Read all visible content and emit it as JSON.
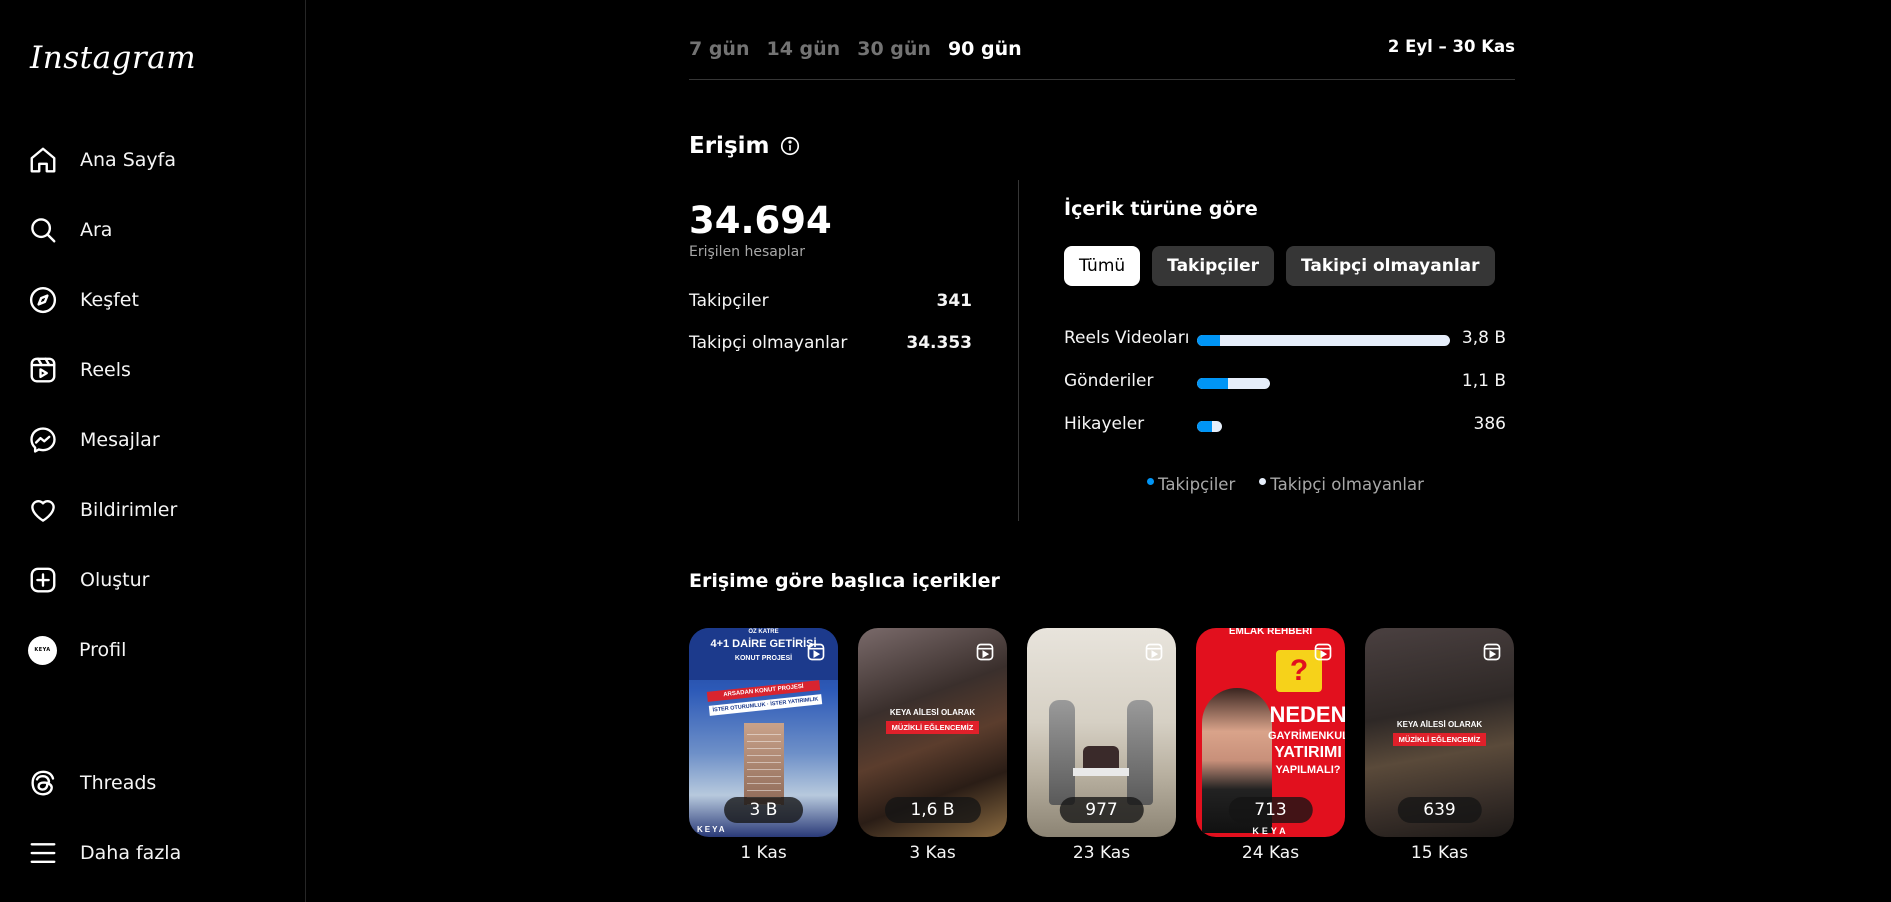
{
  "sidebar": {
    "logo": "Instagram",
    "items": [
      {
        "label": "Ana Sayfa",
        "icon": "home-icon"
      },
      {
        "label": "Ara",
        "icon": "search-icon"
      },
      {
        "label": "Keşfet",
        "icon": "compass-icon"
      },
      {
        "label": "Reels",
        "icon": "reels-icon"
      },
      {
        "label": "Mesajlar",
        "icon": "messenger-icon"
      },
      {
        "label": "Bildirimler",
        "icon": "heart-icon"
      },
      {
        "label": "Oluştur",
        "icon": "plus-square-icon"
      },
      {
        "label": "Profil",
        "icon": "avatar"
      }
    ],
    "bottom_items": [
      {
        "label": "Threads",
        "icon": "threads-icon"
      },
      {
        "label": "Daha fazla",
        "icon": "menu-icon"
      }
    ],
    "avatar_text": "KEYA"
  },
  "range": {
    "tabs": [
      "7 gün",
      "14 gün",
      "30 gün",
      "90 gün"
    ],
    "active": "90 gün",
    "date_range": "2 Eyl – 30 Kas"
  },
  "reach": {
    "title": "Erişim",
    "total": "34.694",
    "total_label": "Erişilen hesaplar",
    "rows": [
      {
        "label": "Takipçiler",
        "value": "341"
      },
      {
        "label": "Takipçi olmayanlar",
        "value": "34.353"
      }
    ]
  },
  "content_type": {
    "title": "İçerik türüne göre",
    "filters": [
      "Tümü",
      "Takipçiler",
      "Takipçi olmayanlar"
    ],
    "active_filter": "Tümü",
    "bars": [
      {
        "label": "Reels Videoları",
        "value": "3,8 B",
        "total_fraction": 1.0,
        "follower_fraction": 0.09
      },
      {
        "label": "Gönderiler",
        "value": "1,1 B",
        "total_fraction": 0.29,
        "follower_fraction": 0.42
      },
      {
        "label": "Hikayeler",
        "value": "386",
        "total_fraction": 0.1,
        "follower_fraction": 0.6
      }
    ],
    "legend": [
      {
        "label": "Takipçiler",
        "color": "#0095f6"
      },
      {
        "label": "Takipçi olmayanlar",
        "color": "#e6eefa"
      }
    ]
  },
  "top_content": {
    "title": "Erişime göre başlıca içerikler",
    "items": [
      {
        "count": "3 B",
        "date": "1 Kas",
        "overlay": [
          "ÖZ KATRE",
          "4+1 DAİRE GETİRİŞİ",
          "KONUT PROJESİ",
          "ARSADAN KONUT PROJESİ",
          "İSTER OTURUMLUK · İSTER YATIRIMLIK",
          "KEYA"
        ]
      },
      {
        "count": "1,6 B",
        "date": "3 Kas",
        "overlay": [
          "KEYA AİLESİ OLARAK",
          "MÜZİKLİ EĞLENCEMİZ"
        ]
      },
      {
        "count": "977",
        "date": "23 Kas",
        "overlay": []
      },
      {
        "count": "713",
        "date": "24 Kas",
        "overlay": [
          "EMLAK REHBERİ",
          "NEDEN",
          "GAYRİMENKUL",
          "YATIRIMI",
          "YAPILMALI?",
          "KEYA"
        ]
      },
      {
        "count": "639",
        "date": "15 Kas",
        "overlay": [
          "KEYA AİLESİ OLARAK",
          "MÜZİKLİ EĞLENCEMİZ"
        ]
      }
    ]
  }
}
